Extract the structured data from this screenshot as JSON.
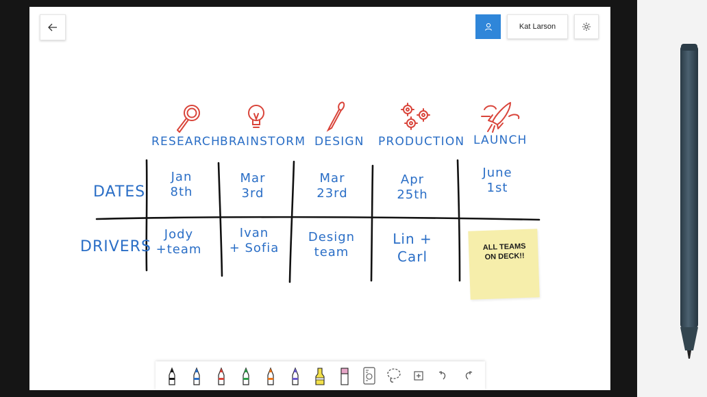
{
  "header": {
    "back_icon": "back-arrow-icon",
    "user_icon": "user-icon",
    "user_name": "Kat Larson",
    "settings_icon": "gear-icon",
    "accent": "#2f86d9"
  },
  "board": {
    "ink_color": "#2a6ec6",
    "icon_color": "#d9443a",
    "stages": [
      {
        "label": "RESEARCH",
        "icon": "magnifier-icon"
      },
      {
        "label": "BRAINSTORM",
        "icon": "lightbulb-icon"
      },
      {
        "label": "DESIGN",
        "icon": "paintbrush-icon"
      },
      {
        "label": "PRODUCTION",
        "icon": "gears-icon"
      },
      {
        "label": "LAUNCH",
        "icon": "rocket-icon"
      }
    ],
    "rows": [
      {
        "label": "DATES",
        "cells": [
          "Jan\n8th",
          "Mar\n3rd",
          "Mar\n23rd",
          "Apr\n25th",
          "June\n1st"
        ]
      },
      {
        "label": "DRIVERS",
        "cells": [
          "Jody\n+team",
          "Ivan\n+ Sofia",
          "Design\nteam",
          "Lin +\nCarl",
          ""
        ]
      }
    ],
    "sticky_note": {
      "text": "ALL TEAMS\nON DECK!!",
      "color": "#f6eeab"
    }
  },
  "toolbar": {
    "tools": [
      {
        "name": "black-pen-icon",
        "color": "#1a1a1a"
      },
      {
        "name": "blue-pen-icon",
        "color": "#2a6ec6"
      },
      {
        "name": "red-pen-icon",
        "color": "#d9443a"
      },
      {
        "name": "green-pen-icon",
        "color": "#2e9e4a"
      },
      {
        "name": "orange-pen-icon",
        "color": "#e8741c"
      },
      {
        "name": "purple-pen-icon",
        "color": "#6a5acd"
      },
      {
        "name": "highlighter-icon",
        "color": "#f2e04a"
      },
      {
        "name": "eraser-icon",
        "color": "#e7a6c8"
      },
      {
        "name": "ruler-icon",
        "color": "#555555"
      },
      {
        "name": "lasso-icon",
        "color": "#555555"
      },
      {
        "name": "add-icon",
        "color": "#555555"
      },
      {
        "name": "undo-icon",
        "color": "#555555"
      },
      {
        "name": "redo-icon",
        "color": "#555555"
      }
    ]
  },
  "surface_pen": {
    "color": "#3b4e5a",
    "icon": "stylus-icon"
  }
}
